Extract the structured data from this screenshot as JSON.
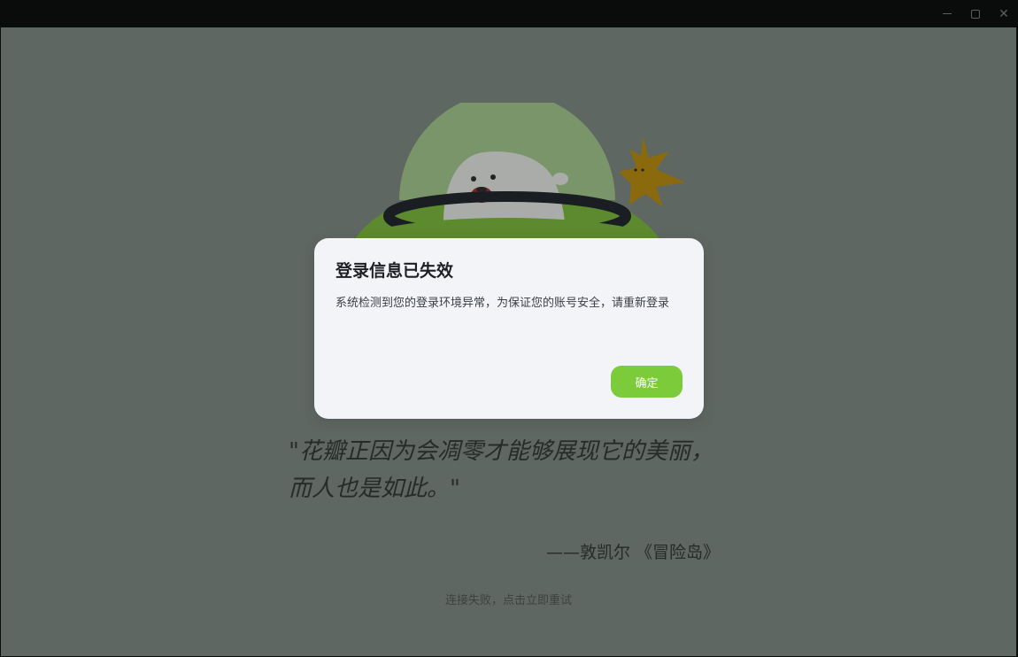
{
  "window": {
    "controls": {
      "minimize": "minimize-icon",
      "maximize": "maximize-icon",
      "close": "close-icon"
    }
  },
  "background": {
    "quote": "\"花瓣正因为会凋零才能够展现它的美丽，而人也是如此。\"",
    "attribution": "——敦凯尔 《冒险岛》",
    "retry_text": "连接失败，点击立即重试"
  },
  "dialog": {
    "title": "登录信息已失效",
    "message": "系统检测到您的登录环境异常，为保证您的账号安全，请重新登录",
    "confirm_label": "确定"
  },
  "colors": {
    "overlay": "#5f6762",
    "dialog_bg": "#f3f4f8",
    "accent": "#7bcb3a"
  }
}
